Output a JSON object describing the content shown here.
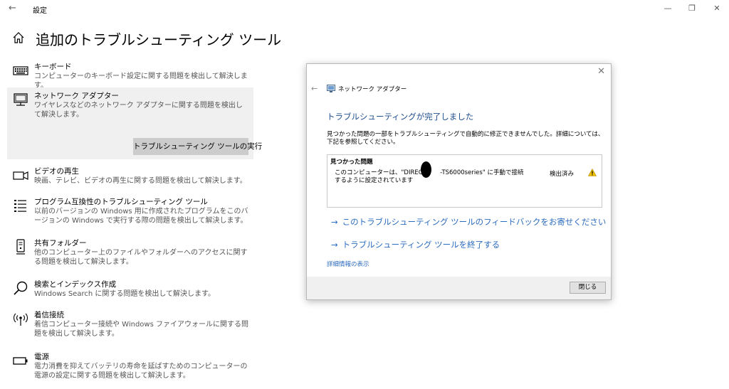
{
  "window": {
    "title": "設定",
    "back_glyph": "←",
    "minimize_glyph": "—",
    "maximize_glyph": "❐",
    "close_glyph": "✕"
  },
  "page": {
    "title": "追加のトラブルシューティング ツール"
  },
  "troubleshooters": [
    {
      "icon": "keyboard-icon",
      "title": "キーボード",
      "description": "コンピューターのキーボード設定に関する問題を検出して解決します。"
    },
    {
      "icon": "network-adapter-icon",
      "title": "ネットワーク アダプター",
      "description": "ワイヤレスなどのネットワーク アダプターに関する問題を検出して解決します。",
      "selected": true,
      "run_button": "トラブルシューティング ツールの実行"
    },
    {
      "icon": "video-icon",
      "title": "ビデオの再生",
      "description": "映画、テレビ、ビデオの再生に関する問題を検出して解決します。"
    },
    {
      "icon": "program-compat-icon",
      "title": "プログラム互換性のトラブルシューティング ツール",
      "description": "以前のバージョンの Windows 用に作成されたプログラムをこのバージョンの Windows で実行する際の問題を検出して解決します。"
    },
    {
      "icon": "shared-folder-icon",
      "title": "共有フォルダー",
      "description": "他のコンピューター上のファイルやフォルダーへのアクセスに関する問題を検出して解決します。"
    },
    {
      "icon": "search-icon",
      "title": "検索とインデックス作成",
      "description": "Windows Search に関する問題を検出して解決します。"
    },
    {
      "icon": "incoming-connection-icon",
      "title": "着信接続",
      "description": "着信コンピューター接続や Windows ファイアウォールに関する問題を検出して解決します。"
    },
    {
      "icon": "battery-icon",
      "title": "電源",
      "description": "電力消費を抑えてバッテリの寿命を延ばすためのコンピューターの電源の設定に関する問題を検出して解決します。"
    }
  ],
  "dialog": {
    "close_glyph": "✕",
    "back_glyph": "←",
    "app_title": "ネットワーク アダプター",
    "heading": "トラブルシューティングが完了しました",
    "description": "見つかった問題の一部をトラブルシューティングで自動的に修正できませんでした。詳細については、下記を参照してください。",
    "problems_header": "見つかった問題",
    "problem_text": "このコンピューターは、\"DIRECT-　　-TS6000series\" に手動で接続するように設定されています",
    "problem_status": "検出済み",
    "link_feedback": "このトラブルシューティング ツールのフィードバックをお寄せください",
    "link_exit": "トラブルシューティング ツールを終了する",
    "link_arrow": "→",
    "detail_link": "詳細情報の表示",
    "close_button": "閉じる"
  },
  "colors": {
    "accent_link": "#2b6bbf",
    "heading_blue": "#1e4e8c",
    "selected_bg": "#f0f0f0",
    "button_bg": "#cccccc",
    "warning": "#f2c200"
  }
}
